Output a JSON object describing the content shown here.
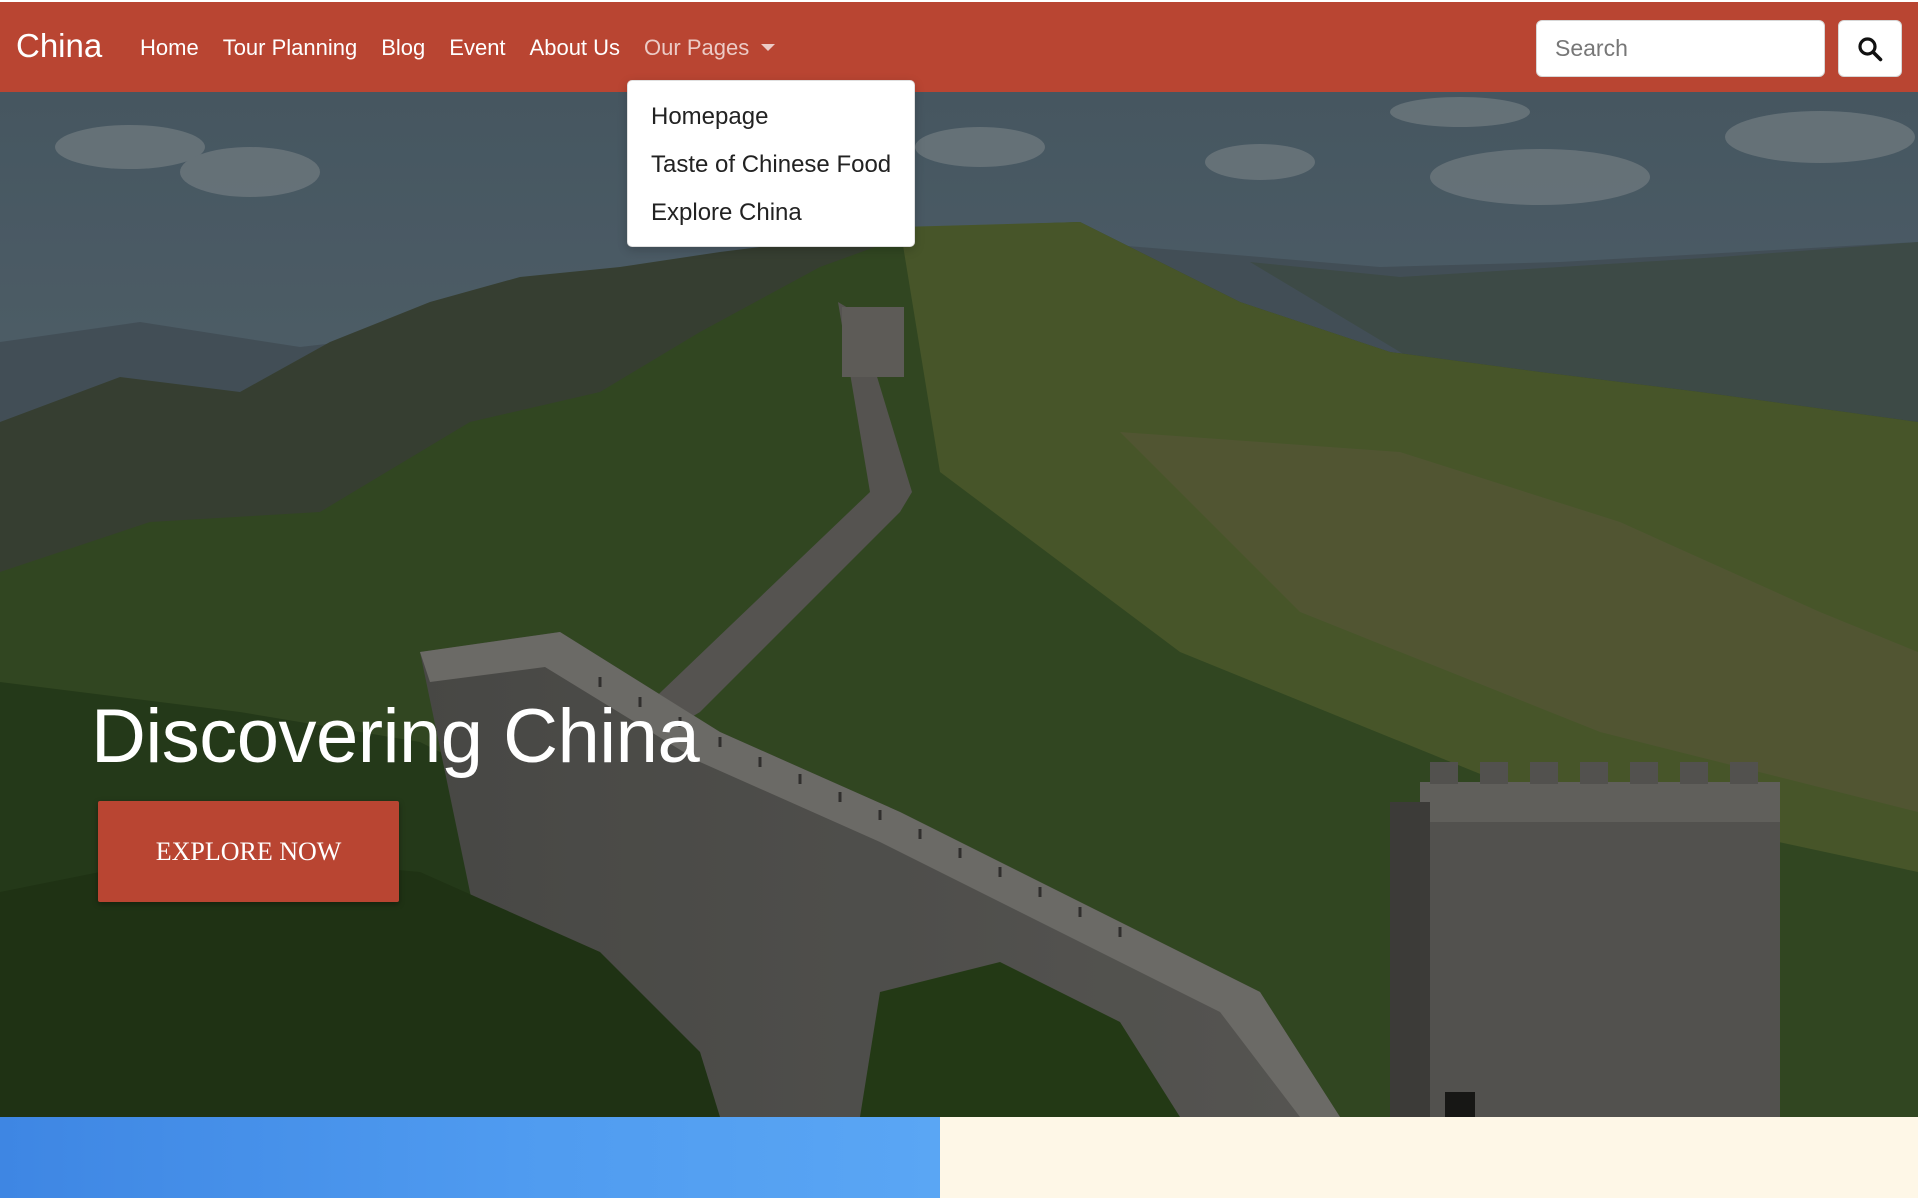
{
  "navbar": {
    "brand": "China",
    "links": [
      "Home",
      "Tour Planning",
      "Blog",
      "Event",
      "About Us"
    ],
    "dropdown_label": "Our Pages",
    "background_color": "#b94532"
  },
  "search": {
    "placeholder": "Search",
    "icon": "search-icon"
  },
  "dropdown": {
    "items": [
      "Homepage",
      "Taste of Chinese Food",
      "Explore China"
    ]
  },
  "hero": {
    "title": "Discovering China",
    "cta_label": "EXPLORE NOW",
    "image": "great-wall-mountain-landscape"
  },
  "sections": {
    "left_color": "#4f9bf0",
    "right_color": "#fef7e7"
  }
}
